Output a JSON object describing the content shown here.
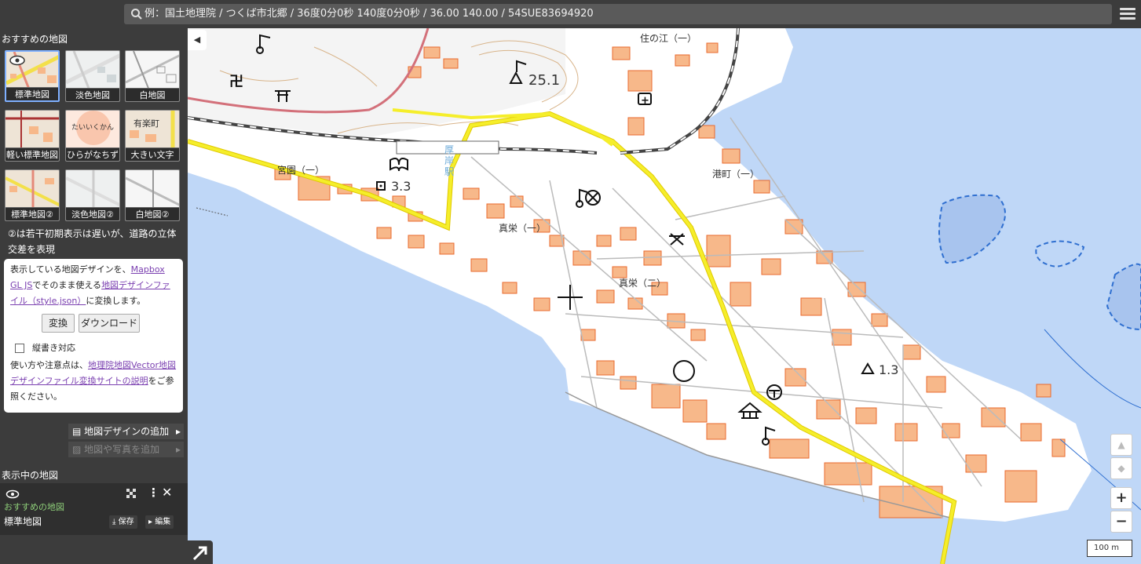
{
  "search": {
    "text": "例：国土地理院 / つくば市北郷 / 36度0分0秒 140度0分0秒  / 36.00 140.00 / 54SUE83694920"
  },
  "sidebar": {
    "recommended_title": "おすすめの地図",
    "thumbnails": [
      {
        "label": "標準地図",
        "selected": true
      },
      {
        "label": "淡色地図",
        "selected": false
      },
      {
        "label": "白地図",
        "selected": false
      },
      {
        "label": "軽い標準地図",
        "selected": false
      },
      {
        "label": "ひらがなちず",
        "selected": false
      },
      {
        "label": "大きい文字",
        "selected": false
      },
      {
        "label": "標準地図②",
        "selected": false
      },
      {
        "label": "淡色地図②",
        "selected": false
      },
      {
        "label": "白地図②",
        "selected": false
      }
    ],
    "thumb_texts": {
      "hiragana": "たいいくかん",
      "ookii": "有楽町"
    },
    "note": "②は若干初期表示は遅いが、道路の立体交差を表現",
    "panel": {
      "line1_a": "表示している地図デザインを、",
      "link_mapbox": "Mapbox GL JS",
      "line1_b": "でそのまま使える",
      "link_design": "地図デザインファイル（style.json）",
      "line1_c": "に変換します。",
      "convert_btn": "変換",
      "download_btn": "ダウンロード",
      "vertical_label": "縦書き対応",
      "usage_a": "使い方や注意点は、",
      "usage_link": "地理院地図Vector地図デザインファイル変換サイトの説明",
      "usage_b": "をご参照ください。"
    },
    "add_design": "地図デザインの追加",
    "add_photo": "地図や写真を追加",
    "active_title": "表示中の地図",
    "active_group": "おすすめの地図",
    "active_name": "標準地図",
    "save_label": "保存",
    "edit_label": "編集"
  },
  "map": {
    "labels": {
      "suminoe": "住の江（一）",
      "miyazono": "宮園（一）",
      "station": "厚岸駅",
      "minatomachi": "港町（一）",
      "shinei1": "真栄（一）",
      "shinei2": "真栄（二）",
      "elev1": "25.1",
      "elev2": "3.3",
      "elev3": "1.3"
    },
    "scale": "100 m",
    "zoom_in": "+",
    "zoom_out": "−"
  },
  "colors": {
    "sea": "#bfd7f7",
    "land": "#ffffff",
    "building": "#f7b88a",
    "building_edge": "#e86a2e",
    "road_major": "#f5ee2a",
    "rail": "#555555",
    "panel_bg": "#3c3c3c"
  }
}
